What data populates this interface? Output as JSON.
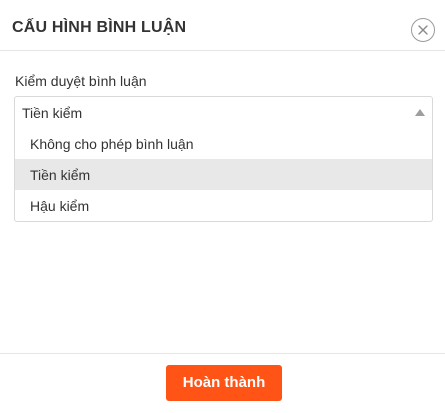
{
  "dialog": {
    "title": "CẤU HÌNH BÌNH LUẬN",
    "close_icon": "close-icon"
  },
  "field": {
    "label": "Kiểm duyệt bình luận",
    "selected_value": "Tiền kiểm",
    "caret_icon": "caret-up-icon",
    "options": [
      {
        "label": "Không cho phép bình luận",
        "selected": false
      },
      {
        "label": "Tiền kiểm",
        "selected": true
      },
      {
        "label": "Hậu kiểm",
        "selected": false
      }
    ]
  },
  "footer": {
    "done_label": "Hoàn thành"
  },
  "colors": {
    "accent": "#ff5416",
    "option_highlight": "#e8e8e8",
    "border": "#d9d9d9"
  }
}
